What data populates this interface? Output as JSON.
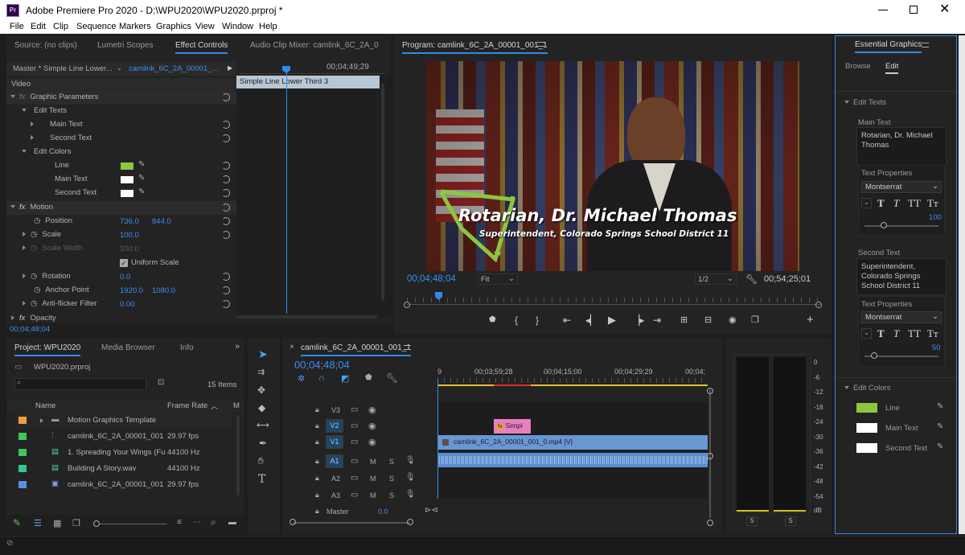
{
  "window": {
    "title": "Adobe Premiere Pro 2020 - D:\\WPU2020\\WPU2020.prproj *",
    "app_badge": "Pr"
  },
  "menu": [
    "File",
    "Edit",
    "Clip",
    "Sequence",
    "Markers",
    "Graphics",
    "View",
    "Window",
    "Help"
  ],
  "source_tabs": [
    "Source: (no clips)",
    "Lumetri Scopes",
    "Effect Controls",
    "Audio Clip Mixer: camlink_6C_2A_0"
  ],
  "effect_controls": {
    "master": "Master * Simple Line Lower...",
    "clip": "camlink_6C_2A_00001_...",
    "timecode_top": "00;04;49;29",
    "clip_bar": "Simple Line Lower Third 3",
    "section_video": "Video",
    "graphic_parameters": "Graphic Parameters",
    "edit_texts": "Edit Texts",
    "main_text": "Main Text",
    "second_text": "Second Text",
    "edit_colors": "Edit Colors",
    "line": "Line",
    "main_text_color": "Main Text",
    "second_text_color": "Second Text",
    "motion": "Motion",
    "position": "Position",
    "position_x": "736.0",
    "position_y": "844.0",
    "scale": "Scale",
    "scale_val": "100.0",
    "scale_width": "Scale Width",
    "scale_width_val": "100.0",
    "uniform_scale": "Uniform Scale",
    "rotation": "Rotation",
    "rotation_val": "0.0",
    "anchor": "Anchor Point",
    "anchor_x": "1920.0",
    "anchor_y": "1080.0",
    "antiflicker": "Anti-flicker Filter",
    "antiflicker_val": "0.00",
    "opacity": "Opacity",
    "timecode_bottom": "00;04;48;04",
    "fx": "fx"
  },
  "program": {
    "tab": "Program: camlink_6C_2A_00001_001_1",
    "main_text": "Rotarian, Dr. Michael Thomas",
    "second_text": "Superintendent, Colorado Springs School District 11",
    "timecode": "00;04;48;04",
    "fit": "Fit",
    "res": "1/2",
    "duration": "00;54;25;01"
  },
  "project": {
    "tabs": [
      "Project: WPU2020",
      "Media Browser",
      "Info"
    ],
    "file": "WPU2020.prproj",
    "items_count": "15 Items",
    "col_name": "Name",
    "col_rate": "Frame Rate",
    "col_m": "M",
    "rows": [
      {
        "name": "Motion Graphics Template",
        "rate": "",
        "color": "#e8a03c"
      },
      {
        "name": "camlink_6C_2A_00001_001",
        "rate": "29.97 fps",
        "color": "#3cc85a"
      },
      {
        "name": "1. Spreading Your Wings (Fu",
        "rate": "44100 Hz",
        "color": "#3cc85a"
      },
      {
        "name": "Building A Story.wav",
        "rate": "44100 Hz",
        "color": "#2ec88c"
      },
      {
        "name": "camlink_6C_2A_00001_001",
        "rate": "29.97 fps",
        "color": "#5a8ee8"
      }
    ]
  },
  "timeline": {
    "tab": "camlink_6C_2A_00001_001_1",
    "timecode": "00;04;48;04",
    "ruler": [
      "9",
      "00;03;59;28",
      "00;04;15;00",
      "00;04;29;29",
      "00;04;"
    ],
    "tracks": [
      {
        "id": "V3",
        "label": "V3"
      },
      {
        "id": "V2",
        "label": "V2"
      },
      {
        "id": "V1",
        "label": "V1"
      },
      {
        "id": "A1",
        "label": "A1"
      },
      {
        "id": "A2",
        "label": "A2"
      },
      {
        "id": "A3",
        "label": "A3"
      }
    ],
    "graphic_clip": "Simpl",
    "video_clip": "camlink_6C_2A_00001_001_0.mp4 [V]",
    "master": "Master",
    "master_val": "0.0",
    "m": "M",
    "s": "S"
  },
  "meters": {
    "scale": [
      "0",
      "-6",
      "-12",
      "-18",
      "-24",
      "-30",
      "-36",
      "-42",
      "-48",
      "-54",
      "dB"
    ],
    "s": "S"
  },
  "essential_graphics": {
    "title": "Essential Graphics",
    "tabs": [
      "Browse",
      "Edit"
    ],
    "edit_texts": "Edit Texts",
    "main_text_label": "Main Text",
    "main_text_val": "Rotarian, Dr. Michael Thomas",
    "text_props": "Text Properties",
    "font": "Montserrat",
    "size1": "100",
    "second_text_label": "Second Text",
    "second_text_val": "Superintendent, Colorado Springs School District 11",
    "size2": "50",
    "edit_colors": "Edit Colors",
    "colors": [
      {
        "label": "Line",
        "color": "#8dc63f"
      },
      {
        "label": "Main Text",
        "color": "#ffffff"
      },
      {
        "label": "Second Text",
        "color": "#ffffff"
      }
    ]
  },
  "colors": {
    "accent": "#2d8ceb",
    "line_green": "#8dc63f",
    "clip_pink": "#e87fc0",
    "clip_blue": "#5a8ed0"
  }
}
